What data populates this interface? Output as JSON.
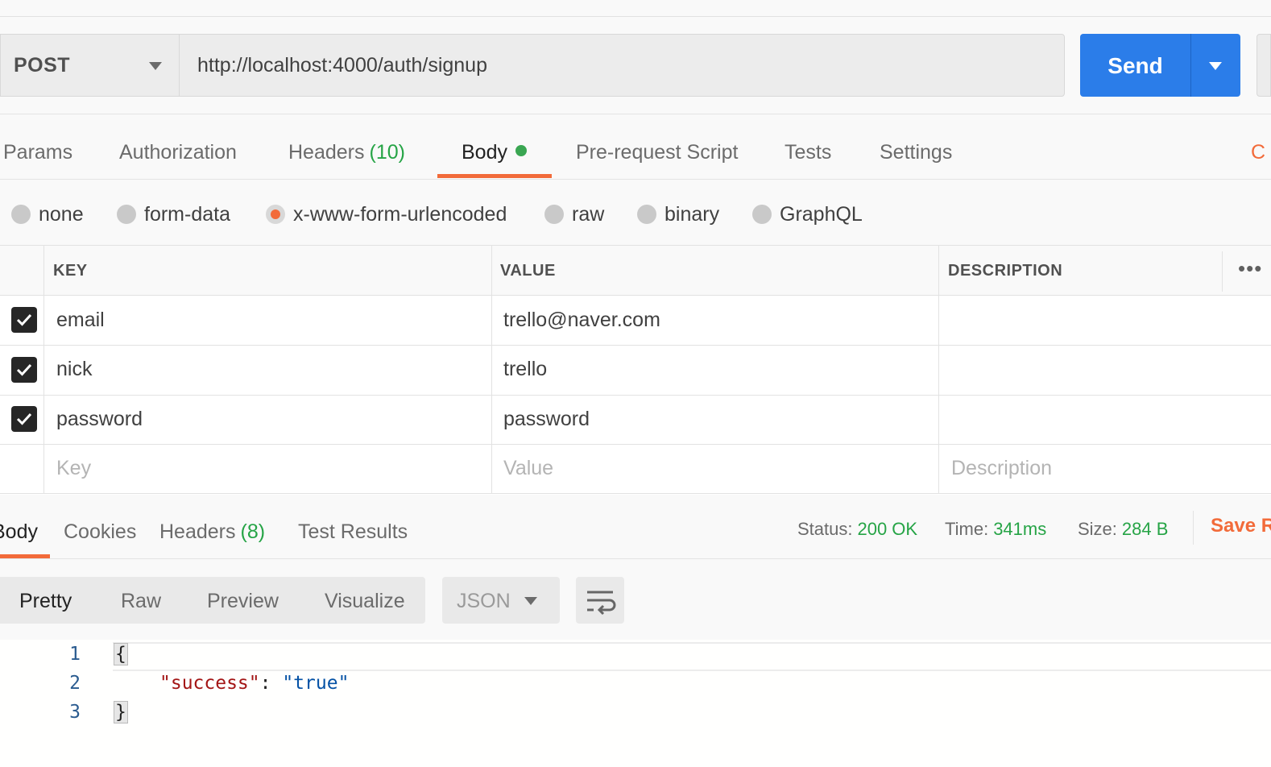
{
  "request": {
    "method": "POST",
    "url": "http://localhost:4000/auth/signup",
    "send_label": "Send"
  },
  "request_tabs": {
    "params": "Params",
    "authorization": "Authorization",
    "headers": "Headers",
    "headers_count": "(10)",
    "body": "Body",
    "prerequest": "Pre-request Script",
    "tests": "Tests",
    "settings": "Settings",
    "cookies_edge": "C"
  },
  "body_types": {
    "none": "none",
    "form_data": "form-data",
    "urlencoded": "x-www-form-urlencoded",
    "raw": "raw",
    "binary": "binary",
    "graphql": "GraphQL",
    "selected": "x-www-form-urlencoded"
  },
  "table": {
    "headers": {
      "key": "KEY",
      "value": "VALUE",
      "description": "DESCRIPTION"
    },
    "rows": [
      {
        "key": "email",
        "value": "trello@naver.com",
        "description": "",
        "checked": true
      },
      {
        "key": "nick",
        "value": "trello",
        "description": "",
        "checked": true
      },
      {
        "key": "password",
        "value": "password",
        "description": "",
        "checked": true
      }
    ],
    "placeholders": {
      "key": "Key",
      "value": "Value",
      "description": "Description"
    },
    "more": "•••"
  },
  "response": {
    "tabs": {
      "body": "Body",
      "cookies": "Cookies",
      "headers": "Headers",
      "headers_count": "(8)",
      "test_results": "Test Results"
    },
    "status_label": "Status:",
    "status_value": "200 OK",
    "time_label": "Time:",
    "time_value": "341ms",
    "size_label": "Size:",
    "size_value": "284 B",
    "save": "Save R",
    "view_modes": {
      "pretty": "Pretty",
      "raw": "Raw",
      "preview": "Preview",
      "visualize": "Visualize"
    },
    "format": "JSON",
    "code": {
      "line_numbers": [
        "1",
        "2",
        "3"
      ],
      "open_brace": "{",
      "key": "\"success\"",
      "colon": ": ",
      "value": "\"true\"",
      "close_brace": "}"
    }
  },
  "colors": {
    "accent_orange": "#f26b3a",
    "send_blue": "#2b7de9",
    "status_green": "#26a446",
    "body_dot_green": "#3aa652"
  }
}
